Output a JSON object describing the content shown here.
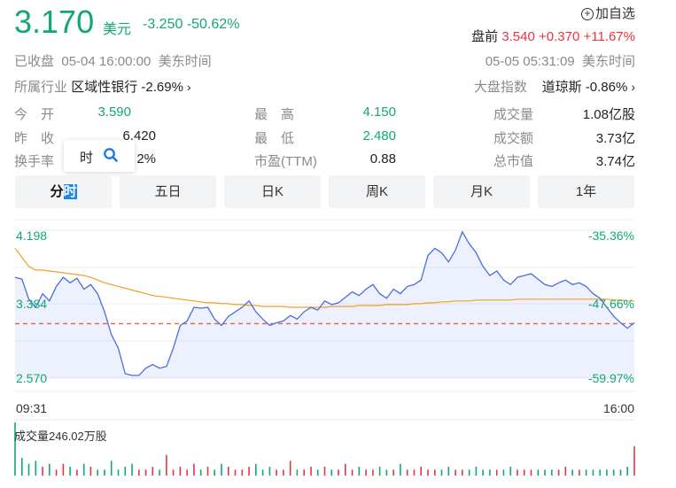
{
  "header": {
    "price": "3.170",
    "currency": "美元",
    "change": "-3.250",
    "change_pct": "-50.62%",
    "add_watch": "加自选",
    "premarket_label": "盘前",
    "premarket_price": "3.540",
    "premarket_change": "+0.370",
    "premarket_pct": "+11.67%",
    "status": "已收盘",
    "close_time": "05-04 16:00:00",
    "close_tz": "美东时间",
    "pre_time": "05-05 05:31:09",
    "pre_tz": "美东时间",
    "industry_label": "所属行业",
    "industry_name": "区域性银行",
    "industry_pct": "-2.69%",
    "index_label": "大盘指数",
    "index_name": "道琼斯",
    "index_pct": "-0.86%"
  },
  "stats": [
    {
      "label": "今　开",
      "value": "3.590"
    },
    {
      "label": "最　高",
      "value": "4.150"
    },
    {
      "label": "成交量",
      "value": "1.08亿股"
    },
    {
      "label": "昨　收",
      "value": "6.420"
    },
    {
      "label": "最　低",
      "value": "2.480"
    },
    {
      "label": "成交额",
      "value": "3.73亿"
    },
    {
      "label": "换手率",
      "value": "2%"
    },
    {
      "label": "市盈(TTM)",
      "value": "0.88"
    },
    {
      "label": "总市值",
      "value": "3.74亿"
    }
  ],
  "tooltip": {
    "text": "时"
  },
  "tabs": [
    {
      "label_a": "分",
      "label_b": "时"
    },
    {
      "label": "五日"
    },
    {
      "label": "日K"
    },
    {
      "label": "周K"
    },
    {
      "label": "月K"
    },
    {
      "label": "1年"
    }
  ],
  "colors": {
    "up": "#e8333f",
    "down": "#12a779",
    "price_line": "#4a6ee0",
    "avg_line": "#f0a020",
    "ref_line": "#e8603c"
  },
  "chart_data": {
    "type": "line",
    "y_left_ticks": [
      "4.198",
      "3.384",
      "2.570"
    ],
    "y_right_ticks": [
      "-35.36%",
      "-47.66%",
      "-59.97%"
    ],
    "x_ticks": [
      "09:31",
      "16:00"
    ],
    "ylim": [
      2.57,
      4.198
    ],
    "reference": 3.17,
    "volume_label": "成交量246.02万股",
    "series": [
      {
        "values": [
          3.68,
          3.66,
          3.44,
          3.35,
          3.5,
          3.42,
          3.58,
          3.68,
          3.62,
          3.67,
          3.55,
          3.6,
          3.5,
          3.3,
          3.05,
          2.9,
          2.62,
          2.6,
          2.6,
          2.68,
          2.72,
          2.68,
          2.7,
          2.9,
          3.15,
          3.2,
          3.35,
          3.34,
          3.35,
          3.22,
          3.15,
          3.25,
          3.3,
          3.35,
          3.42,
          3.3,
          3.22,
          3.15,
          3.18,
          3.2,
          3.26,
          3.22,
          3.3,
          3.35,
          3.32,
          3.42,
          3.38,
          3.4,
          3.46,
          3.52,
          3.48,
          3.55,
          3.6,
          3.5,
          3.45,
          3.55,
          3.5,
          3.58,
          3.6,
          3.65,
          3.92,
          4.0,
          3.95,
          3.85,
          3.98,
          4.18,
          4.05,
          3.95,
          3.8,
          3.7,
          3.75,
          3.65,
          3.6,
          3.68,
          3.7,
          3.72,
          3.66,
          3.6,
          3.58,
          3.62,
          3.65,
          3.6,
          3.62,
          3.58,
          3.5,
          3.45,
          3.35,
          3.25,
          3.18,
          3.12,
          3.18
        ]
      },
      {
        "values": [
          4.0,
          3.9,
          3.8,
          3.76,
          3.76,
          3.75,
          3.74,
          3.73,
          3.72,
          3.71,
          3.7,
          3.68,
          3.65,
          3.62,
          3.6,
          3.58,
          3.56,
          3.54,
          3.52,
          3.5,
          3.48,
          3.47,
          3.46,
          3.45,
          3.44,
          3.43,
          3.42,
          3.41,
          3.4,
          3.4,
          3.39,
          3.39,
          3.38,
          3.38,
          3.37,
          3.37,
          3.36,
          3.36,
          3.36,
          3.36,
          3.35,
          3.35,
          3.35,
          3.35,
          3.35,
          3.35,
          3.36,
          3.36,
          3.36,
          3.36,
          3.37,
          3.37,
          3.37,
          3.37,
          3.38,
          3.38,
          3.38,
          3.38,
          3.39,
          3.39,
          3.4,
          3.4,
          3.41,
          3.41,
          3.42,
          3.42,
          3.42,
          3.43,
          3.43,
          3.43,
          3.43,
          3.43,
          3.43,
          3.44,
          3.44,
          3.44,
          3.44,
          3.44,
          3.44,
          3.44,
          3.44,
          3.44,
          3.44,
          3.44,
          3.44,
          3.44,
          3.44,
          3.43,
          3.43,
          3.42,
          3.42
        ]
      }
    ],
    "volume": [
      0.9,
      0.3,
      0.2,
      0.25,
      0.15,
      0.2,
      0.1,
      0.2,
      0.15,
      0.1,
      0.2,
      0.15,
      0.1,
      0.1,
      0.25,
      0.1,
      0.15,
      0.2,
      0.1,
      0.1,
      0.15,
      0.1,
      0.35,
      0.1,
      0.15,
      0.1,
      0.2,
      0.1,
      0.15,
      0.1,
      0.2,
      0.15,
      0.1,
      0.1,
      0.15,
      0.2,
      0.1,
      0.15,
      0.1,
      0.1,
      0.25,
      0.1,
      0.1,
      0.15,
      0.1,
      0.15,
      0.1,
      0.1,
      0.2,
      0.1,
      0.15,
      0.1,
      0.1,
      0.15,
      0.1,
      0.1,
      0.2,
      0.1,
      0.1,
      0.15,
      0.1,
      0.1,
      0.1,
      0.15,
      0.1,
      0.1,
      0.1,
      0.15,
      0.1,
      0.1,
      0.1,
      0.1,
      0.15,
      0.1,
      0.1,
      0.1,
      0.1,
      0.1,
      0.1,
      0.1,
      0.15,
      0.1,
      0.1,
      0.1,
      0.1,
      0.1,
      0.1,
      0.1,
      0.1,
      0.15,
      0.5
    ]
  }
}
